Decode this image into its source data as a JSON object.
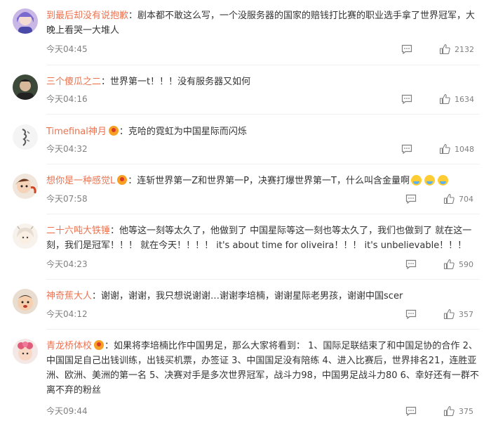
{
  "comments": [
    {
      "username": "到最后却没有说抱歉",
      "sep": "：",
      "text": "剧本都不敢这么写，一个没服务器的国家的赔钱打比赛的职业选手拿了世界冠军，大晚上看哭一大堆人",
      "time": "今天04:45",
      "likes": "2132"
    },
    {
      "username": "三个傻瓜之二",
      "sep": "：",
      "text": "世界第一t！！！没有服务器又如何",
      "time": "今天04:16",
      "likes": "1634"
    },
    {
      "username": "Timefinal神月",
      "sep": "：",
      "text": "克哈的霓虹为中国星际而闪烁",
      "time": "今天04:32",
      "likes": "1048"
    },
    {
      "username": "想你是一种感觉L",
      "sep": "：",
      "text": "连斩世界第一Z和世界第一P，决赛打爆世界第一T，什么叫含金量啊",
      "time": "今天07:58",
      "likes": "704"
    },
    {
      "username": "二十六吨大铁锤",
      "sep": "：",
      "text": "他等这一刻等太久了，他做到了 中国星际等这一刻也等太久了，我们也做到了 就在这一刻，我们是冠军！！！ 就在今天！！！！ it's about time for oliveira！！！ it's unbelievable！！！",
      "time": "今天04:23",
      "likes": "590"
    },
    {
      "username": "神奇蕉大人",
      "sep": "：",
      "text": "谢谢，谢谢，我只想说谢谢…谢谢李培楠，谢谢星际老男孩，谢谢中国scer",
      "time": "今天04:12",
      "likes": "357"
    },
    {
      "username": "青龙桥体校",
      "sep": "：",
      "text": "如果将李培楠比作中国男足，那么大家将看到： 1、国际足联结束了和中国足协的合作 2、中国国足自己出钱训练，出钱买机票，办签证 3、中国国足没有陪练 4、进入比赛后，世界排名21，连胜亚洲、欧洲、美洲的第一名 5、决赛对手是多次世界冠军，战斗力98，中国男足战斗力80 6、幸好还有一群不离不弃的粉丝",
      "time": "今天09:44",
      "likes": "375"
    }
  ],
  "icons": {
    "reply": "comment-bubble-icon",
    "like": "thumbs-up-icon",
    "badge": "vip-badge-icon",
    "emoji": "crying-emoji-icon"
  },
  "colors": {
    "username": "#eb7350",
    "text": "#333333",
    "meta": "#808080"
  }
}
